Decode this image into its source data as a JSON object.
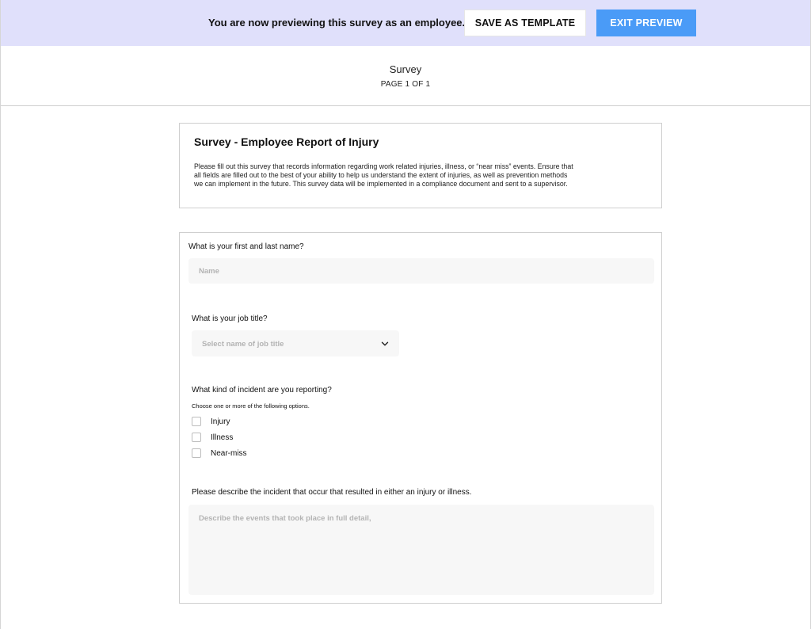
{
  "banner": {
    "message": "You are now previewing this survey as an employee.",
    "save_template_label": "SAVE AS TEMPLATE",
    "exit_preview_label": "EXIT PREVIEW",
    "background_color": "#e0e0fb",
    "exit_button_color": "#4a9bf7"
  },
  "header": {
    "survey_name": "Survey",
    "page_indicator": "PAGE 1 OF 1"
  },
  "intro": {
    "title": "Survey - Employee Report of Injury",
    "description": "Please fill out this survey that records information regarding work related injuries, illness, or “near miss” events. Ensure that all fields are filled out to the best of your ability to help us understand the extent of injuries, as well as prevention methods we can implement in the future. This survey data will be implemented in a compliance document and sent to a supervisor."
  },
  "form": {
    "name_question": {
      "label": "What is your first and last name?",
      "value": "",
      "placeholder": "Name"
    },
    "job_question": {
      "label": "What is your job title?",
      "placeholder": "Select name of job title",
      "icon": "chevron-down-icon"
    },
    "incident_question": {
      "label": "What kind of incident are you reporting?",
      "hint": "Choose one or more of the following options.",
      "options": [
        {
          "label": "Injury",
          "checked": false
        },
        {
          "label": "Illness",
          "checked": false
        },
        {
          "label": "Near-miss",
          "checked": false
        }
      ]
    },
    "description_question": {
      "label": "Please describe the incident that occur that resulted in either an injury or illness.",
      "value": "",
      "placeholder": "Describe the events that took place in full detail,"
    }
  }
}
